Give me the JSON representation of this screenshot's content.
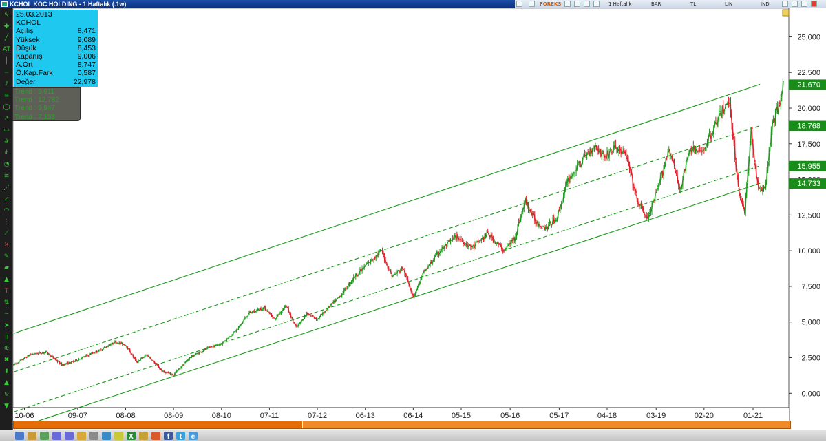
{
  "window": {
    "title": "KCHOL KOC HOLDING - 1 Haftalık (.1w)"
  },
  "toolbar": {
    "brand": "FOREKS",
    "period": "1 Haftalık",
    "bar_mode": "BAR",
    "currency": "TL",
    "scale": "LIN",
    "ind": "IND"
  },
  "info_panel": {
    "date": "25.03.2013",
    "symbol": "KCHOL",
    "rows": [
      {
        "label": "Açılış",
        "value": "8,471"
      },
      {
        "label": "Yüksek",
        "value": "9,089"
      },
      {
        "label": "Düşük",
        "value": "8,453"
      },
      {
        "label": "Kapanış",
        "value": "9,006"
      },
      {
        "label": "A.Ort",
        "value": "8,747"
      },
      {
        "label": "Ö.Kap.Fark",
        "value": "0,587"
      },
      {
        "label": "Değer",
        "value": "22,978"
      }
    ]
  },
  "trend_panel": [
    "Trend : 5,911",
    "Trend : 12,782",
    "Trend : 9,947",
    "Trend : 7,133"
  ],
  "price_labels": [
    "21,670",
    "18,768",
    "15,955",
    "14,733"
  ],
  "colors": {
    "up": "#1d9a1d",
    "down": "#e0202a",
    "trend": "#1a9a1a",
    "info_bg": "#1ec8ee",
    "price_label_bg": "#1a8c1a",
    "scroll": "#f08a28"
  },
  "left_tools": [
    "cursor-arrow-icon",
    "crosshair-icon",
    "trendline-icon",
    "text-AT-icon",
    "vertical-line-icon",
    "horizontal-line-icon",
    "channel-icon",
    "fibonacci-icon",
    "ellipse-icon",
    "arrow-icon",
    "rectangle-icon",
    "gann-icon",
    "pitchfork-icon",
    "cycle-icon",
    "regression-icon",
    "speed-line-icon",
    "fan-icon",
    "arc-icon",
    "timezone-icon",
    "zigzag-icon",
    "cross-icon",
    "pencil-icon",
    "eraser-icon",
    "brush-icon",
    "text-T-icon",
    "mirror-icon",
    "tilde-icon",
    "pointer-icon",
    "rect-icon",
    "zoom-icon",
    "trash-icon",
    "magnet-icon",
    "lock-icon",
    "alert-icon",
    "scroll-arrow-icon"
  ],
  "bottom_icons": [
    "save-icon",
    "print-icon",
    "chart-icon",
    "zoom-in-icon",
    "zoom-out-icon",
    "image-icon",
    "template-icon",
    "layout-icon",
    "settings-icon",
    "excel-icon",
    "folder-icon",
    "edit-icon",
    "facebook-icon",
    "twitter-icon",
    "web-icon"
  ],
  "chart_data": {
    "type": "candlestick",
    "title": "",
    "ylim": [
      -1000,
      27000
    ],
    "yticks": [
      0,
      2500,
      5000,
      7500,
      10000,
      12500,
      15000,
      17500,
      20000,
      22500,
      25000
    ],
    "ytick_labels": [
      "0,000",
      "2,500",
      "5,000",
      "7,500",
      "10,000",
      "12,500",
      "15,000",
      "17,500",
      "20,000",
      "22,500",
      "25,000"
    ],
    "xtick_labels": [
      "10-06",
      "09-07",
      "08-08",
      "08-09",
      "08-10",
      "07-11",
      "07-12",
      "06-13",
      "06-14",
      "05-15",
      "05-16",
      "05-17",
      "04-18",
      "03-19",
      "02-20",
      "01-21"
    ],
    "xtick_index": [
      10,
      60,
      105,
      150,
      195,
      240,
      285,
      330,
      375,
      420,
      466,
      512,
      557,
      603,
      648,
      694
    ],
    "trendlines": [
      {
        "name": "Trend",
        "value": 5.911,
        "start": [
          0,
          4200
        ],
        "end": [
          698,
          21670
        ],
        "style": "solid"
      },
      {
        "name": "Trend",
        "value": 12.782,
        "start": [
          0,
          1500
        ],
        "end": [
          698,
          18768
        ],
        "style": "dashed"
      },
      {
        "name": "Trend",
        "value": 9.947,
        "start": [
          0,
          -1300
        ],
        "end": [
          698,
          15955
        ],
        "style": "dashed"
      },
      {
        "name": "Trend",
        "value": 7.133,
        "start": [
          0,
          -2500
        ],
        "end": [
          698,
          14733
        ],
        "style": "solid"
      }
    ],
    "series_anchors": [
      [
        0,
        2000
      ],
      [
        15,
        2700
      ],
      [
        30,
        2900
      ],
      [
        45,
        2000
      ],
      [
        55,
        2200
      ],
      [
        70,
        2700
      ],
      [
        80,
        3000
      ],
      [
        95,
        3600
      ],
      [
        105,
        3400
      ],
      [
        115,
        2200
      ],
      [
        125,
        2700
      ],
      [
        140,
        1500
      ],
      [
        150,
        1300
      ],
      [
        165,
        2500
      ],
      [
        180,
        3100
      ],
      [
        195,
        3500
      ],
      [
        210,
        4500
      ],
      [
        220,
        5600
      ],
      [
        235,
        6000
      ],
      [
        245,
        5200
      ],
      [
        255,
        6200
      ],
      [
        265,
        4600
      ],
      [
        275,
        5600
      ],
      [
        285,
        5200
      ],
      [
        295,
        6000
      ],
      [
        305,
        6700
      ],
      [
        320,
        8200
      ],
      [
        335,
        9300
      ],
      [
        345,
        10000
      ],
      [
        355,
        8200
      ],
      [
        365,
        8800
      ],
      [
        375,
        6800
      ],
      [
        385,
        8500
      ],
      [
        400,
        10000
      ],
      [
        415,
        11000
      ],
      [
        430,
        10200
      ],
      [
        445,
        11200
      ],
      [
        460,
        10000
      ],
      [
        470,
        10900
      ],
      [
        480,
        13500
      ],
      [
        490,
        12000
      ],
      [
        500,
        11600
      ],
      [
        510,
        12400
      ],
      [
        520,
        14900
      ],
      [
        535,
        16500
      ],
      [
        545,
        17400
      ],
      [
        555,
        16600
      ],
      [
        565,
        17300
      ],
      [
        575,
        16600
      ],
      [
        585,
        13500
      ],
      [
        595,
        12200
      ],
      [
        605,
        14500
      ],
      [
        615,
        17200
      ],
      [
        625,
        14300
      ],
      [
        635,
        17200
      ],
      [
        645,
        16800
      ],
      [
        655,
        18300
      ],
      [
        665,
        19800
      ],
      [
        672,
        20500
      ],
      [
        680,
        14300
      ],
      [
        686,
        12800
      ],
      [
        692,
        18300
      ],
      [
        698,
        14600
      ],
      [
        705,
        14200
      ],
      [
        712,
        19000
      ],
      [
        718,
        20000
      ],
      [
        722,
        22000
      ]
    ]
  }
}
